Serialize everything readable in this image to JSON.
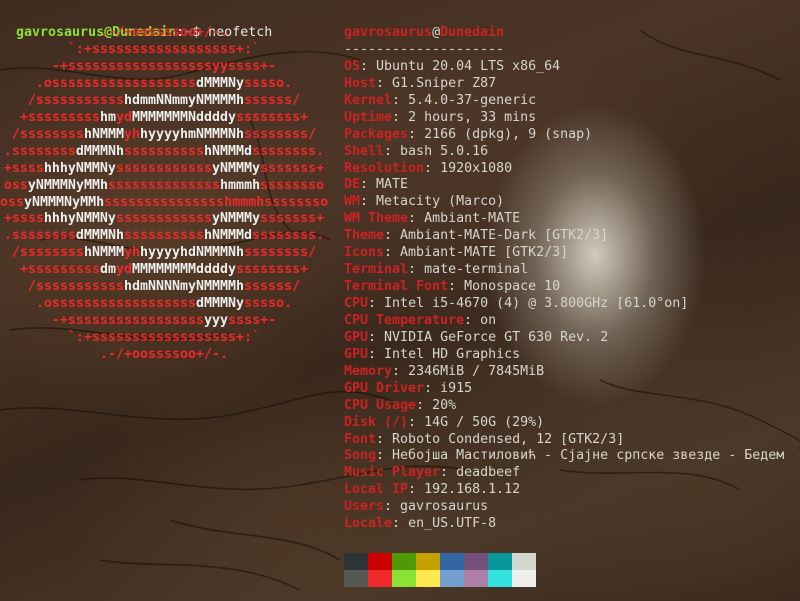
{
  "prompt": {
    "user_host": "gavrosaurus@Dunedain",
    "colon": ":",
    "path": "~",
    "symbol": "$ ",
    "command": "neofetch"
  },
  "logo": [
    [
      {
        "t": ".-/+oossssoo+/-.",
        "w": false
      }
    ],
    [
      {
        "t": "`:+ssssssssssssssssss+:`",
        "w": false
      }
    ],
    [
      {
        "t": "-+ssssssssssssssssssyyssss+-",
        "w": false
      }
    ],
    [
      {
        "t": ".ossssssssssssssssss",
        "w": false
      },
      {
        "t": "dMMMNy",
        "w": true
      },
      {
        "t": "sssso.",
        "w": false
      }
    ],
    [
      {
        "t": "/sssssssssss",
        "w": false
      },
      {
        "t": "hdmmNNmmyNMMMMh",
        "w": true
      },
      {
        "t": "ssssss/",
        "w": false
      }
    ],
    [
      {
        "t": "+sssssssss",
        "w": false
      },
      {
        "t": "hm",
        "w": true
      },
      {
        "t": "yd",
        "w": false
      },
      {
        "t": "MMMMMMMNddddy",
        "w": true
      },
      {
        "t": "ssssssss+",
        "w": false
      }
    ],
    [
      {
        "t": "/ssssssss",
        "w": false
      },
      {
        "t": "hNMMM",
        "w": true
      },
      {
        "t": "yh",
        "w": false
      },
      {
        "t": "hyyyyhmNMMMNh",
        "w": true
      },
      {
        "t": "ssssssss/",
        "w": false
      }
    ],
    [
      {
        "t": ".ssssssss",
        "w": false
      },
      {
        "t": "dMMMNh",
        "w": true
      },
      {
        "t": "ssssssssss",
        "w": false
      },
      {
        "t": "hNMMMd",
        "w": true
      },
      {
        "t": "ssssssss.",
        "w": false
      }
    ],
    [
      {
        "t": "+ssss",
        "w": false
      },
      {
        "t": "hhhyNMMNy",
        "w": true
      },
      {
        "t": "ssssssssssss",
        "w": false
      },
      {
        "t": "yNMMMy",
        "w": true
      },
      {
        "t": "sssssss+",
        "w": false
      }
    ],
    [
      {
        "t": "oss",
        "w": false
      },
      {
        "t": "yNMMMNyMMh",
        "w": true
      },
      {
        "t": "ssssssssssssss",
        "w": false
      },
      {
        "t": "hmmmh",
        "w": true
      },
      {
        "t": "ssssssso",
        "w": false
      }
    ],
    [
      {
        "t": "oss",
        "w": false
      },
      {
        "t": "yNMMMNyMMh",
        "w": true
      },
      {
        "t": "sssssssssssssss",
        "w": false
      },
      {
        "t": "hmmmhssssssso",
        "w": false
      }
    ],
    [
      {
        "t": "+ssss",
        "w": false
      },
      {
        "t": "hhhyNMMNy",
        "w": true
      },
      {
        "t": "ssssssssssss",
        "w": false
      },
      {
        "t": "yNMMMy",
        "w": true
      },
      {
        "t": "sssssss+",
        "w": false
      }
    ],
    [
      {
        "t": ".ssssssss",
        "w": false
      },
      {
        "t": "dMMMNh",
        "w": true
      },
      {
        "t": "ssssssssss",
        "w": false
      },
      {
        "t": "hNMMMd",
        "w": true
      },
      {
        "t": "ssssssss.",
        "w": false
      }
    ],
    [
      {
        "t": "/ssssssss",
        "w": false
      },
      {
        "t": "hNMMM",
        "w": true
      },
      {
        "t": "yh",
        "w": false
      },
      {
        "t": "hyyyyhdNMMMNh",
        "w": true
      },
      {
        "t": "ssssssss/",
        "w": false
      }
    ],
    [
      {
        "t": "+sssssssss",
        "w": false
      },
      {
        "t": "dm",
        "w": true
      },
      {
        "t": "yd",
        "w": false
      },
      {
        "t": "MMMMMMMMddddy",
        "w": true
      },
      {
        "t": "ssssssss+",
        "w": false
      }
    ],
    [
      {
        "t": "/sssssssssss",
        "w": false
      },
      {
        "t": "hdmNNNNmyNMMMMh",
        "w": true
      },
      {
        "t": "ssssss/",
        "w": false
      }
    ],
    [
      {
        "t": ".ossssssssssssssssss",
        "w": false
      },
      {
        "t": "dMMMNy",
        "w": true
      },
      {
        "t": "sssso.",
        "w": false
      }
    ],
    [
      {
        "t": "-+sssssssssssssssss",
        "w": false
      },
      {
        "t": "yyy",
        "w": true
      },
      {
        "t": "ssss+-",
        "w": false
      }
    ],
    [
      {
        "t": "`:+ssssssssssssssssss+:`",
        "w": false
      }
    ],
    [
      {
        "t": ".-/+oossssoo+/-.",
        "w": false
      }
    ]
  ],
  "info": {
    "title_user": "gavrosaurus",
    "title_at": "@",
    "title_host": "Dunedain",
    "separator": "--------------------",
    "rows": [
      {
        "k": "OS",
        "v": "Ubuntu 20.04 LTS x86_64"
      },
      {
        "k": "Host",
        "v": "G1.Sniper Z87"
      },
      {
        "k": "Kernel",
        "v": "5.4.0-37-generic"
      },
      {
        "k": "Uptime",
        "v": "2 hours, 33 mins"
      },
      {
        "k": "Packages",
        "v": "2166 (dpkg), 9 (snap)"
      },
      {
        "k": "Shell",
        "v": "bash 5.0.16"
      },
      {
        "k": "Resolution",
        "v": "1920x1080"
      },
      {
        "k": "DE",
        "v": "MATE"
      },
      {
        "k": "WM",
        "v": "Metacity (Marco)"
      },
      {
        "k": "WM Theme",
        "v": "Ambiant-MATE"
      },
      {
        "k": "Theme",
        "v": "Ambiant-MATE-Dark [GTK2/3]"
      },
      {
        "k": "Icons",
        "v": "Ambiant-MATE [GTK2/3]"
      },
      {
        "k": "Terminal",
        "v": "mate-terminal"
      },
      {
        "k": "Terminal Font",
        "v": "Monospace 10"
      },
      {
        "k": "CPU",
        "v": "Intel i5-4670 (4) @ 3.800GHz [61.0°on]"
      },
      {
        "k": "CPU Temperature",
        "v": "on"
      },
      {
        "k": "GPU",
        "v": "NVIDIA GeForce GT 630 Rev. 2"
      },
      {
        "k": "GPU",
        "v": "Intel HD Graphics"
      },
      {
        "k": "Memory",
        "v": "2346MiB / 7845MiB"
      },
      {
        "k": "GPU Driver",
        "v": "i915"
      },
      {
        "k": "CPU Usage",
        "v": "20%"
      },
      {
        "k": "Disk (/)",
        "v": "14G / 50G (29%)"
      },
      {
        "k": "Font",
        "v": "Roboto Condensed, 12 [GTK2/3]"
      },
      {
        "k": "Song",
        "v": "Небојша Мастиловић - Сјајне српске звезде - Бедем"
      },
      {
        "k": "Music Player",
        "v": "deadbeef"
      },
      {
        "k": "Local IP",
        "v": "192.168.1.12"
      },
      {
        "k": "Users",
        "v": "gavrosaurus"
      },
      {
        "k": "Locale",
        "v": "en_US.UTF-8"
      }
    ]
  },
  "palette": {
    "normal": [
      "#2e3436",
      "#cc0000",
      "#4e9a06",
      "#c4a000",
      "#3465a4",
      "#75507b",
      "#06989a",
      "#d3d7cf"
    ],
    "bright": [
      "#555753",
      "#ef2929",
      "#8ae234",
      "#fce94f",
      "#729fcf",
      "#ad7fa8",
      "#34e2e2",
      "#eeeeec"
    ]
  }
}
